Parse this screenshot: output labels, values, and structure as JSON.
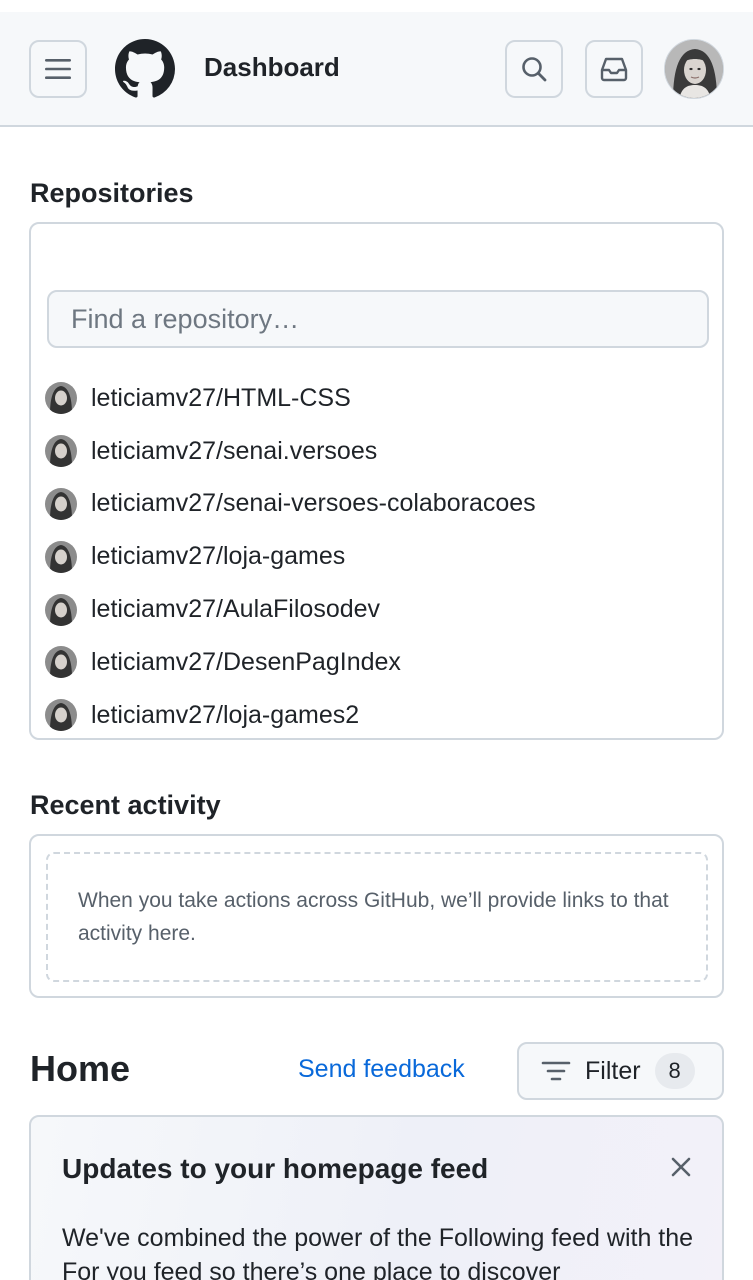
{
  "header": {
    "title": "Dashboard",
    "menu_icon": "hamburger-menu-icon",
    "logo_icon": "github-logo-icon",
    "search_icon": "search-icon",
    "inbox_icon": "inbox-icon"
  },
  "repositories": {
    "title": "Repositories",
    "search_placeholder": "Find a repository…",
    "items": [
      {
        "name": "leticiamv27/HTML-CSS"
      },
      {
        "name": "leticiamv27/senai.versoes"
      },
      {
        "name": "leticiamv27/senai-versoes-colaboracoes"
      },
      {
        "name": "leticiamv27/loja-games"
      },
      {
        "name": "leticiamv27/AulaFilosodev"
      },
      {
        "name": "leticiamv27/DesenPagIndex"
      },
      {
        "name": "leticiamv27/loja-games2"
      }
    ]
  },
  "activity": {
    "title": "Recent activity",
    "empty_message": "When you take actions across GitHub, we’ll provide links to that activity here."
  },
  "home": {
    "title": "Home",
    "feedback_label": "Send feedback",
    "filter_label": "Filter",
    "filter_count": "8",
    "filter_icon": "filter-icon"
  },
  "updates": {
    "title": "Updates to your homepage feed",
    "body": "We've combined the power of the Following feed with the For you feed so there’s one place to discover",
    "close_icon": "close-icon"
  },
  "colors": {
    "accent": "#0969da",
    "border": "#d0d7de",
    "header_bg": "#f6f8fa"
  }
}
